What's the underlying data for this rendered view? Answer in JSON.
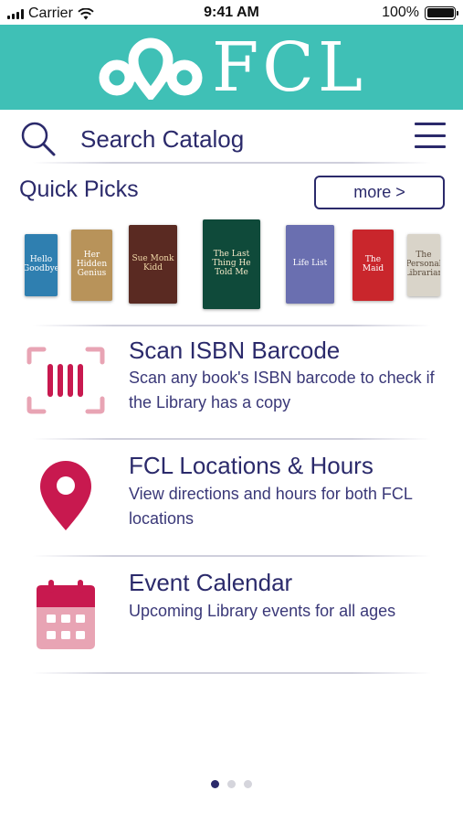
{
  "status_bar": {
    "carrier": "Carrier",
    "time": "9:41 AM",
    "battery_percent": "100%",
    "battery_level": 1.0
  },
  "header": {
    "logo_text": "FCL",
    "background_color": "#3fc0b6"
  },
  "search": {
    "placeholder": "Search Catalog",
    "icon": "search-icon",
    "menu_icon": "menu-icon"
  },
  "quick_picks": {
    "title": "Quick Picks",
    "more_label": "more >",
    "books": [
      {
        "title": "Hello Goodbye",
        "color": "#2f7fb0",
        "text_color": "#ffffff"
      },
      {
        "title": "Her Hidden Genius",
        "color": "#b8935a",
        "text_color": "#ffffff"
      },
      {
        "title": "Sue Monk Kidd",
        "color": "#5a2a22",
        "text_color": "#f1d9a8"
      },
      {
        "title": "The Last Thing He Told Me",
        "color": "#0f4a3a",
        "text_color": "#f5e9c8"
      },
      {
        "title": "Life List",
        "color": "#6a6fb0",
        "text_color": "#ffffff"
      },
      {
        "title": "The Maid",
        "color": "#c9262c",
        "text_color": "#ffffff"
      },
      {
        "title": "The Personal Librarian",
        "color": "#d9d4c9",
        "text_color": "#5a4a3a"
      }
    ]
  },
  "features": [
    {
      "title": "Scan ISBN Barcode",
      "description": "Scan any book's ISBN barcode to check if the Library has a copy",
      "icon": "barcode-scan-icon"
    },
    {
      "title": "FCL Locations & Hours",
      "description": "View directions and hours for both FCL locations",
      "icon": "map-pin-icon"
    },
    {
      "title": "Event Calendar",
      "description": "Upcoming Library events for all ages",
      "icon": "calendar-icon"
    }
  ],
  "pager": {
    "count": 3,
    "active": 1
  },
  "colors": {
    "primary": "#2b2a6b",
    "accent": "#3fc0b6",
    "icon_pink": "#e8a4b4",
    "icon_red": "#c8194f"
  }
}
